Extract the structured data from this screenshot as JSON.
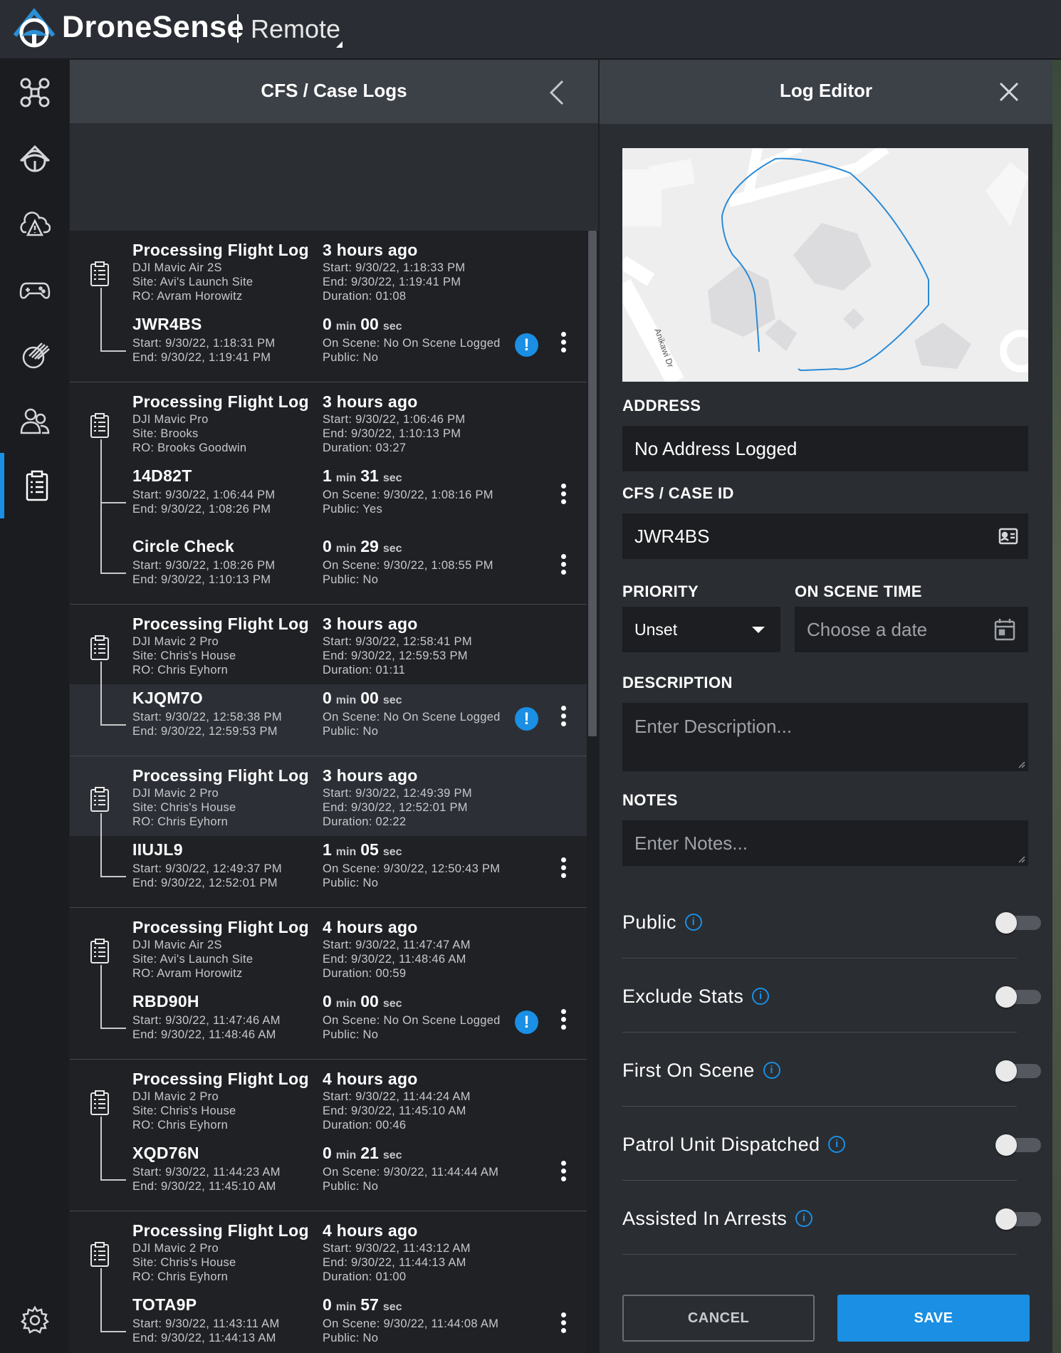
{
  "app": {
    "brand": "DroneSense",
    "product": "Remote"
  },
  "nav": [
    {
      "icon": "drone-icon"
    },
    {
      "icon": "launch-site-icon"
    },
    {
      "icon": "alert-icon"
    },
    {
      "icon": "controller-icon"
    },
    {
      "icon": "fire-icon"
    },
    {
      "icon": "users-icon"
    },
    {
      "icon": "logs-icon",
      "active": true
    },
    {
      "icon": "settings-icon"
    }
  ],
  "cfs": {
    "title": "CFS / Case Logs",
    "groups": [
      {
        "flight": {
          "title": "Processing Flight Log",
          "model": "DJI Mavic Air 2S",
          "site": "Site: Avi's Launch Site",
          "ro": "RO: Avram Horowitz",
          "ago": "3 hours ago",
          "start": "Start: 9/30/22, 1:18:33 PM",
          "end": "End: 9/30/22, 1:19:41 PM",
          "duration": "Duration: 01:08"
        },
        "cases": [
          {
            "id": "JWR4BS",
            "start": "Start: 9/30/22, 1:18:31 PM",
            "end": "End: 9/30/22, 1:19:41 PM",
            "min": "0",
            "sec": "00",
            "onscene": "On Scene: No On Scene Logged",
            "public": "Public: No",
            "warn": true
          }
        ]
      },
      {
        "flight": {
          "title": "Processing Flight Log",
          "model": "DJI Mavic Pro",
          "site": "Site: Brooks",
          "ro": "RO: Brooks Goodwin",
          "ago": "3 hours ago",
          "start": "Start: 9/30/22, 1:06:46 PM",
          "end": "End: 9/30/22, 1:10:13 PM",
          "duration": "Duration: 03:27"
        },
        "cases": [
          {
            "id": "14D82T",
            "start": "Start: 9/30/22, 1:06:44 PM",
            "end": "End: 9/30/22, 1:08:26 PM",
            "min": "1",
            "sec": "31",
            "onscene": "On Scene: 9/30/22, 1:08:16 PM",
            "public": "Public: Yes",
            "warn": false
          },
          {
            "id": "Circle Check",
            "start": "Start: 9/30/22, 1:08:26 PM",
            "end": "End: 9/30/22, 1:10:13 PM",
            "min": "0",
            "sec": "29",
            "onscene": "On Scene: 9/30/22, 1:08:55 PM",
            "public": "Public: No",
            "warn": false
          }
        ]
      },
      {
        "flight": {
          "title": "Processing Flight Log",
          "model": "DJI Mavic 2 Pro",
          "site": "Site: Chris's House",
          "ro": "RO: Chris Eyhorn",
          "ago": "3 hours ago",
          "start": "Start: 9/30/22, 12:58:41 PM",
          "end": "End: 9/30/22, 12:59:53 PM",
          "duration": "Duration: 01:11"
        },
        "cases": [
          {
            "id": "KJQM7O",
            "start": "Start: 9/30/22, 12:58:38 PM",
            "end": "End: 9/30/22, 12:59:53 PM",
            "min": "0",
            "sec": "00",
            "onscene": "On Scene: No On Scene Logged",
            "public": "Public: No",
            "warn": true,
            "highlight": true
          }
        ]
      },
      {
        "flight": {
          "title": "Processing Flight Log",
          "model": "DJI Mavic 2 Pro",
          "site": "Site: Chris's House",
          "ro": "RO: Chris Eyhorn",
          "ago": "3 hours ago",
          "start": "Start: 9/30/22, 12:49:39 PM",
          "end": "End: 9/30/22, 12:52:01 PM",
          "duration": "Duration: 02:22",
          "highlight": true
        },
        "cases": [
          {
            "id": "IIUJL9",
            "start": "Start: 9/30/22, 12:49:37 PM",
            "end": "End: 9/30/22, 12:52:01 PM",
            "min": "1",
            "sec": "05",
            "onscene": "On Scene: 9/30/22, 12:50:43 PM",
            "public": "Public: No",
            "warn": false
          }
        ]
      },
      {
        "flight": {
          "title": "Processing Flight Log",
          "model": "DJI Mavic Air 2S",
          "site": "Site: Avi's Launch Site",
          "ro": "RO: Avram Horowitz",
          "ago": "4 hours ago",
          "start": "Start: 9/30/22, 11:47:47 AM",
          "end": "End: 9/30/22, 11:48:46 AM",
          "duration": "Duration: 00:59"
        },
        "cases": [
          {
            "id": "RBD90H",
            "start": "Start: 9/30/22, 11:47:46 AM",
            "end": "End: 9/30/22, 11:48:46 AM",
            "min": "0",
            "sec": "00",
            "onscene": "On Scene: No On Scene Logged",
            "public": "Public: No",
            "warn": true
          }
        ]
      },
      {
        "flight": {
          "title": "Processing Flight Log",
          "model": "DJI Mavic 2 Pro",
          "site": "Site: Chris's House",
          "ro": "RO: Chris Eyhorn",
          "ago": "4 hours ago",
          "start": "Start: 9/30/22, 11:44:24 AM",
          "end": "End: 9/30/22, 11:45:10 AM",
          "duration": "Duration: 00:46"
        },
        "cases": [
          {
            "id": "XQD76N",
            "start": "Start: 9/30/22, 11:44:23 AM",
            "end": "End: 9/30/22, 11:45:10 AM",
            "min": "0",
            "sec": "21",
            "onscene": "On Scene: 9/30/22, 11:44:44 AM",
            "public": "Public: No",
            "warn": false
          }
        ]
      },
      {
        "flight": {
          "title": "Processing Flight Log",
          "model": "DJI Mavic 2 Pro",
          "site": "Site: Chris's House",
          "ro": "RO: Chris Eyhorn",
          "ago": "4 hours ago",
          "start": "Start: 9/30/22, 11:43:12 AM",
          "end": "End: 9/30/22, 11:44:13 AM",
          "duration": "Duration: 01:00"
        },
        "cases": [
          {
            "id": "TOTA9P",
            "start": "Start: 9/30/22, 11:43:11 AM",
            "end": "End: 9/30/22, 11:44:13 AM",
            "min": "0",
            "sec": "57",
            "onscene": "On Scene: 9/30/22, 11:44:08 AM",
            "public": "Public: No",
            "warn": false
          }
        ]
      }
    ],
    "min_unit": "min",
    "sec_unit": "sec"
  },
  "editor": {
    "title": "Log Editor",
    "map_street": "Anikawi Dr",
    "address_label": "ADDRESS",
    "address_value": "No Address Logged",
    "caseid_label": "CFS / CASE ID",
    "caseid_value": "JWR4BS",
    "priority_label": "PRIORITY",
    "priority_value": "Unset",
    "onscene_label": "ON SCENE TIME",
    "onscene_placeholder": "Choose a date",
    "description_label": "DESCRIPTION",
    "description_placeholder": "Enter Description...",
    "notes_label": "NOTES",
    "notes_placeholder": "Enter Notes...",
    "toggles": [
      {
        "label": "Public",
        "on": false
      },
      {
        "label": "Exclude Stats",
        "on": false
      },
      {
        "label": "First On Scene",
        "on": false
      },
      {
        "label": "Patrol Unit Dispatched",
        "on": false
      },
      {
        "label": "Assisted In Arrests",
        "on": false
      }
    ],
    "cancel": "CANCEL",
    "save": "SAVE"
  },
  "colors": {
    "accent": "#1a8fe3",
    "panel": "#2a2d32",
    "header": "#3c4047"
  }
}
